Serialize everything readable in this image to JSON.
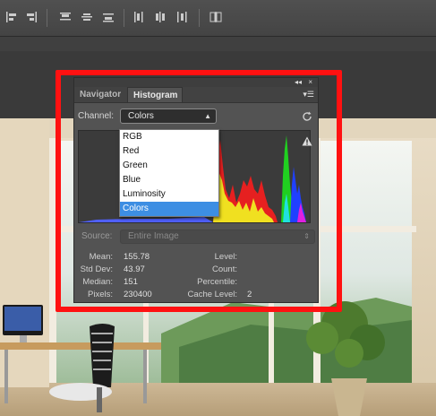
{
  "panel": {
    "tabs": [
      "Navigator",
      "Histogram"
    ],
    "collapse": "◂◂",
    "close": "×",
    "menu": "▾☰",
    "channel_label": "Channel:",
    "channel_value": "Colors",
    "channel_options": [
      "RGB",
      "Red",
      "Green",
      "Blue",
      "Luminosity",
      "Colors"
    ],
    "source_label": "Source:",
    "source_value": "Entire Image",
    "stats_left": [
      {
        "k": "Mean:",
        "v": "155.78"
      },
      {
        "k": "Std Dev:",
        "v": "43.97"
      },
      {
        "k": "Median:",
        "v": "151"
      },
      {
        "k": "Pixels:",
        "v": "230400"
      }
    ],
    "stats_right": [
      {
        "k": "Level:",
        "v": ""
      },
      {
        "k": "Count:",
        "v": ""
      },
      {
        "k": "Percentile:",
        "v": ""
      },
      {
        "k": "Cache Level:",
        "v": "2"
      }
    ]
  },
  "colors": {
    "highlight_box": "#ff1111",
    "selected_option": "#3d8ee3",
    "panel_bg": "#535353"
  },
  "icons": [
    "align-left-icon",
    "align-right-icon",
    "distribute-top-icon",
    "distribute-vcenter-icon",
    "distribute-bottom-icon",
    "distribute-left-icon",
    "distribute-hcenter-icon",
    "distribute-right-icon",
    "auto-align-icon",
    "refresh-icon",
    "warning-icon"
  ]
}
